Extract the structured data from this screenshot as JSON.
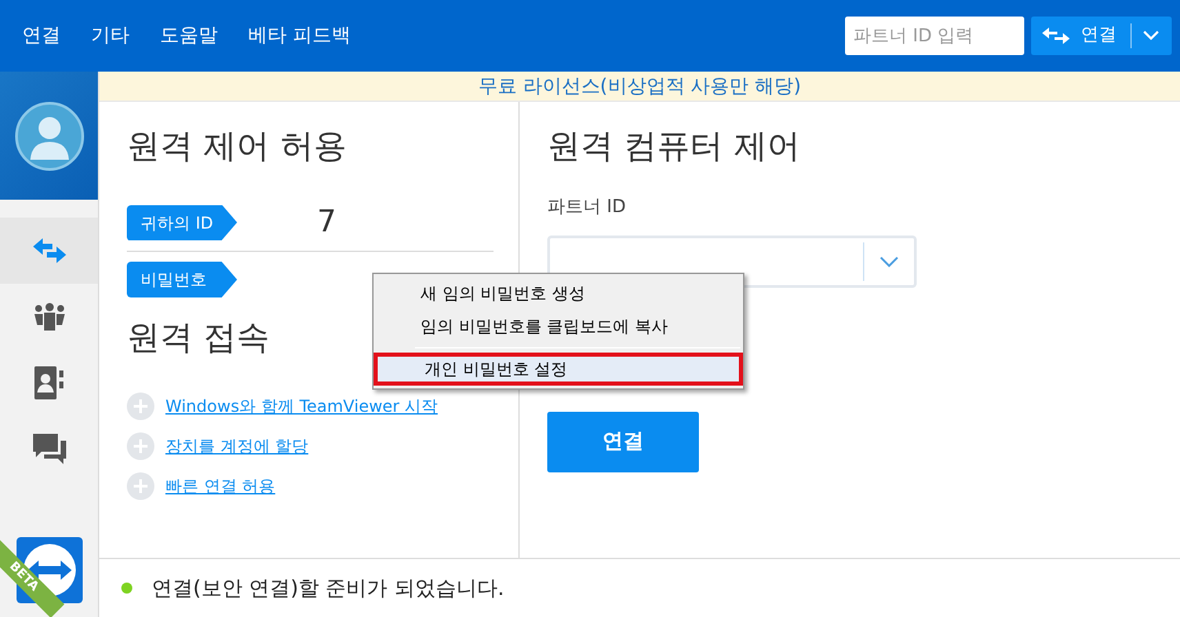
{
  "menu_bar": [
    {
      "label": "연결"
    },
    {
      "label": "기타"
    },
    {
      "label": "도움말"
    },
    {
      "label": "베타 피드백"
    }
  ],
  "top_search": {
    "placeholder": "파트너 ID 입력"
  },
  "top_connect": {
    "label": "연결"
  },
  "banner": "무료 라이선스(비상업적 사용만 해당)",
  "sidebar": {
    "items": [
      {
        "kind": "connect",
        "selected": true
      },
      {
        "kind": "meeting",
        "selected": false
      },
      {
        "kind": "contacts",
        "selected": false
      },
      {
        "kind": "chat",
        "selected": false
      }
    ],
    "badge": "BETA"
  },
  "allow_panel": {
    "title": "원격 제어 허용",
    "id_label": "귀하의 ID",
    "id_value": "7",
    "password_label": "비밀번호"
  },
  "unattended": {
    "title": "원격 접속",
    "links": [
      {
        "label": "Windows와 함께 TeamViewer 시작"
      },
      {
        "label": "장치를 계정에 할당"
      },
      {
        "label": "빠른 연결 허용"
      }
    ]
  },
  "control_panel": {
    "title": "원격 컴퓨터 제어",
    "partner_label": "파트너 ID",
    "connect_button": "연결"
  },
  "context_menu": {
    "items": [
      {
        "label": "새 임의 비밀번호 생성",
        "selected": false,
        "highlighted": false
      },
      {
        "label": "임의 비밀번호를 클립보드에 복사",
        "selected": false,
        "highlighted": false
      },
      {
        "label": "개인 비밀번호 설정",
        "selected": true,
        "highlighted": true
      }
    ]
  },
  "status_bar": {
    "text": "연결(보안 연결)할 준비가 되었습니다.",
    "color": "#7ed321"
  }
}
